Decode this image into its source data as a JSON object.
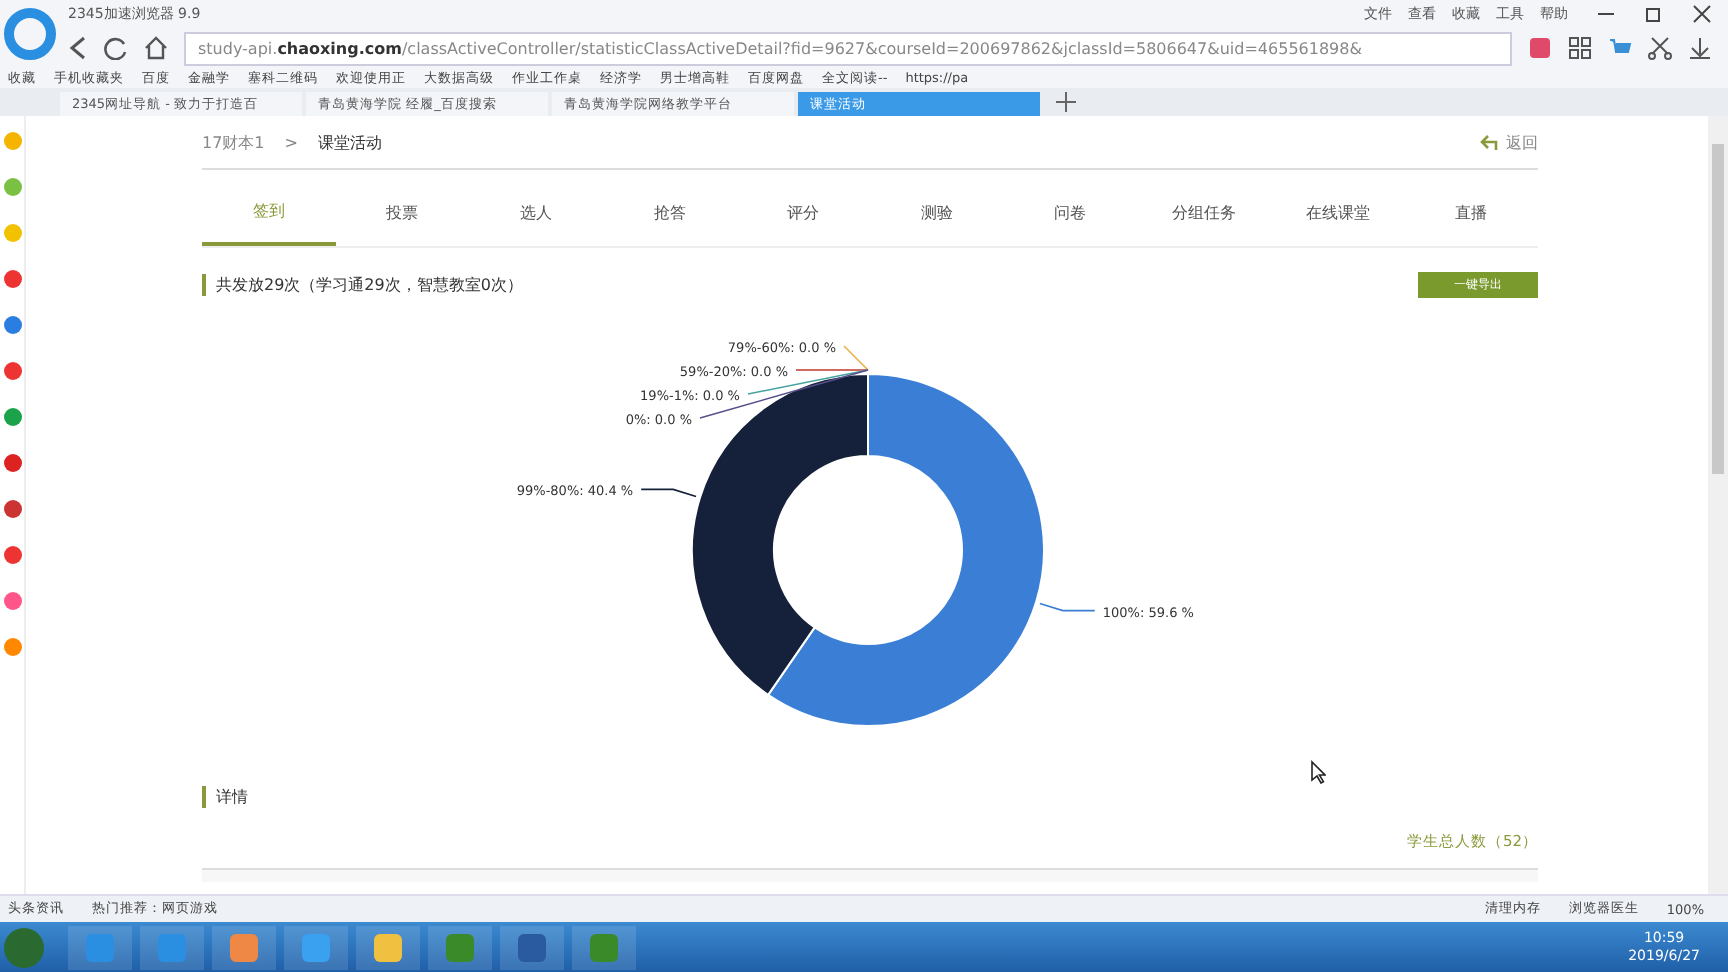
{
  "window": {
    "title": "2345加速浏览器 9.9",
    "menu": [
      "文件",
      "查看",
      "收藏",
      "工具",
      "帮助"
    ]
  },
  "address_bar": {
    "url_prefix": "study-api.",
    "url_domain": "chaoxing.com",
    "url_path": "/classActiveController/statisticClassActiveDetail?fid=9627&courseId=200697862&jclassId=5806647&uid=465561898&"
  },
  "bookmarks": [
    "收藏",
    "手机收藏夹",
    "百度",
    "金融学",
    "塞科二维码",
    "欢迎使用正",
    "大数据高级",
    "作业工作桌",
    "经济学",
    "男士增高鞋",
    "百度网盘",
    "全文阅读--",
    "https://pa"
  ],
  "tabs": [
    {
      "label": "2345网址导航 - 致力于打造百",
      "selected": false
    },
    {
      "label": "青岛黄海学院 经履_百度搜索",
      "selected": false
    },
    {
      "label": "青岛黄海学院网络教学平台",
      "selected": false
    },
    {
      "label": "课堂活动",
      "selected": true
    }
  ],
  "breadcrumb": {
    "parent": "17财本1",
    "separator": ">",
    "current": "课堂活动",
    "back": "返回"
  },
  "activity_tabs": [
    {
      "label": "签到",
      "selected": true
    },
    {
      "label": "投票",
      "selected": false
    },
    {
      "label": "选人",
      "selected": false
    },
    {
      "label": "抢答",
      "selected": false
    },
    {
      "label": "评分",
      "selected": false
    },
    {
      "label": "测验",
      "selected": false
    },
    {
      "label": "问卷",
      "selected": false
    },
    {
      "label": "分组任务",
      "selected": false
    },
    {
      "label": "在线课堂",
      "selected": false
    },
    {
      "label": "直播",
      "selected": false
    }
  ],
  "summary": "共发放29次（学习通29次，智慧教室0次）",
  "export_button": "一键导出",
  "chart_data": {
    "type": "donut",
    "categories": [
      "100%: 59.6 %",
      "99%-80%: 40.4 %",
      "79%-60%: 0.0 %",
      "59%-20%: 0.0 %",
      "19%-1%: 0.0 %",
      "0%: 0.0 %"
    ],
    "values": [
      59.6,
      40.4,
      0.0,
      0.0,
      0.0,
      0.0
    ]
  },
  "details_title": "详情",
  "student_total": "学生总人数（52）",
  "status_bar": {
    "news": "头条资讯",
    "recommend": "热门推荐：网页游戏",
    "clean": "清理内存",
    "doctor": "浏览器医生",
    "zoom": "100%"
  },
  "taskbar": {
    "time": "10:59",
    "date": "2019/6/27"
  }
}
